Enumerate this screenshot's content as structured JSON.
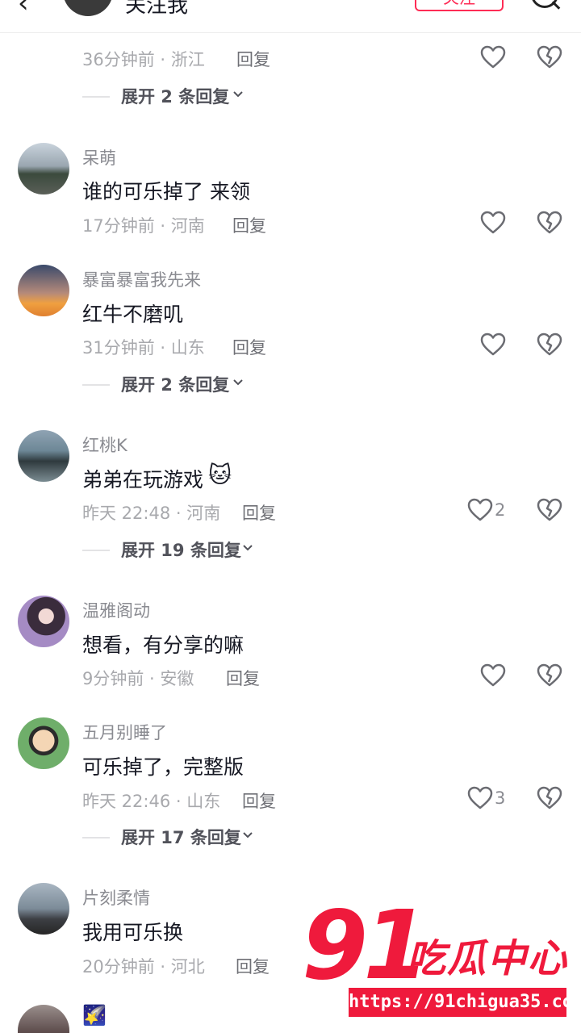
{
  "header": {
    "back_glyph": "‹",
    "name": "关注我",
    "follow_label": "关注"
  },
  "top_partial": {
    "time_location": "36分钟前 · 浙江",
    "reply": "回复",
    "expand": "展开 2 条回复"
  },
  "comments": [
    {
      "username": "呆萌",
      "text": "谁的可乐掉了 来领",
      "time_location": "17分钟前 · 河南",
      "reply": "回复",
      "likes": ""
    },
    {
      "username": "暴富暴富我先来",
      "text": "红牛不磨叽",
      "time_location": "31分钟前 · 山东",
      "reply": "回复",
      "likes": "",
      "expand": "展开 2 条回复"
    },
    {
      "username": "红桃K",
      "text": "弟弟在玩游戏",
      "emoji": "🐱",
      "time_location": "昨天 22:48 · 河南",
      "reply": "回复",
      "likes": "2",
      "expand": "展开 19 条回复"
    },
    {
      "username": "温雅阁动",
      "text": "想看，有分享的嘛",
      "time_location": "9分钟前 · 安徽",
      "reply": "回复",
      "likes": ""
    },
    {
      "username": "五月别睡了",
      "text": "可乐掉了，完整版",
      "time_location": "昨天 22:46 · 山东",
      "reply": "回复",
      "likes": "3",
      "expand": "展开 17 条回复"
    },
    {
      "username": "片刻柔情",
      "text": "我用可乐换",
      "time_location": "20分钟前 · 河北",
      "reply": "回复",
      "likes": ""
    }
  ],
  "last_partial": {
    "username_emoji": "🌠"
  },
  "watermark": {
    "logo_number": "91",
    "logo_text": "吃瓜中心",
    "url": "https://91chigua35.com"
  },
  "colors": {
    "accent": "#fe2c55",
    "watermark": "#ef1a3c"
  }
}
